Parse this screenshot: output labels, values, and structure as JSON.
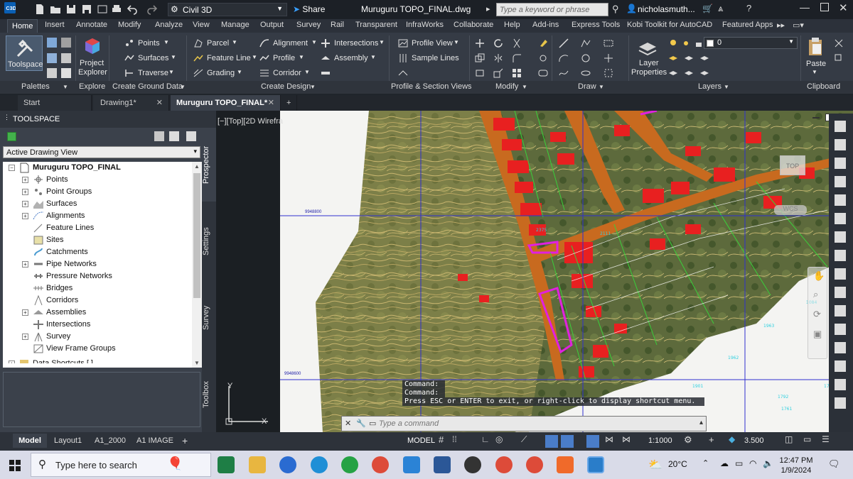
{
  "titlebar": {
    "app_badge": "C3D",
    "workspace": "Civil 3D",
    "share": "Share",
    "file_title": "Muruguru TOPO_FINAL.dwg",
    "search_placeholder": "Type a keyword or phrase",
    "user": "nicholasmuth..."
  },
  "ribbon_tabs": [
    "Home",
    "Insert",
    "Annotate",
    "Modify",
    "Analyze",
    "View",
    "Manage",
    "Output",
    "Survey",
    "Rail",
    "Transparent",
    "InfraWorks",
    "Collaborate",
    "Help",
    "Add-ins",
    "Express Tools",
    "Kobi Toolkit for AutoCAD",
    "Featured Apps"
  ],
  "ribbon": {
    "toolspace": "Toolspace",
    "project_explorer": [
      "Project",
      "Explorer"
    ],
    "points": "Points",
    "surfaces": "Surfaces",
    "traverse": "Traverse",
    "parcel": "Parcel",
    "feature_line": "Feature Line",
    "grading": "Grading",
    "alignment": "Alignment",
    "profile": "Profile",
    "corridor": "Corridor",
    "intersections": "Intersections",
    "assembly": "Assembly",
    "profile_view": "Profile View",
    "sample_lines": "Sample Lines",
    "layer_value": "0",
    "layer_properties": [
      "Layer",
      "Properties"
    ],
    "paste": "Paste",
    "panel_titles": [
      "Palettes",
      "Explore",
      "Create Ground Data",
      "Create Design",
      "Profile & Section Views",
      "Modify",
      "Draw",
      "Layers",
      "Clipboard"
    ]
  },
  "doc_tabs": [
    "Start",
    "Drawing1*",
    "Muruguru TOPO_FINAL*"
  ],
  "toolspace": {
    "title": "TOOLSPACE",
    "view_combo": "Active Drawing View",
    "root": "Muruguru TOPO_FINAL",
    "items": [
      "Points",
      "Point Groups",
      "Surfaces",
      "Alignments",
      "Feature Lines",
      "Sites",
      "Catchments",
      "Pipe Networks",
      "Pressure Networks",
      "Bridges",
      "Corridors",
      "Assemblies",
      "Intersections",
      "Survey",
      "View Frame Groups",
      "Data Shortcuts [ ]"
    ],
    "vertical_tabs": [
      "Prospector",
      "Settings",
      "Survey",
      "Toolbox"
    ]
  },
  "viewport": {
    "label": "[−][Top][2D Wirefra",
    "viewcube_top": "TOP",
    "wcs": "WCS",
    "grid_labels": [
      "9948800",
      "9948600"
    ],
    "command_history": [
      "Command:",
      "Command:",
      "Press ESC or ENTER to exit, or right-click to display shortcut menu."
    ],
    "command_placeholder": "Type a command"
  },
  "layout_tabs": [
    "Model",
    "Layout1",
    "A1_2000",
    "A1 IMAGE"
  ],
  "statusbar": {
    "model": "MODEL",
    "scale": "1:1000",
    "lineweight": "3.500"
  },
  "taskbar": {
    "search_placeholder": "Type here to search",
    "temperature": "20°C",
    "time": "12:47 PM",
    "date": "1/9/2024"
  },
  "colors": {
    "ribbon_bg": "#353b45",
    "title_bg": "#1c2026",
    "taskbar_bg": "#d9dbe8",
    "accent_blue": "#0a5fb4"
  }
}
